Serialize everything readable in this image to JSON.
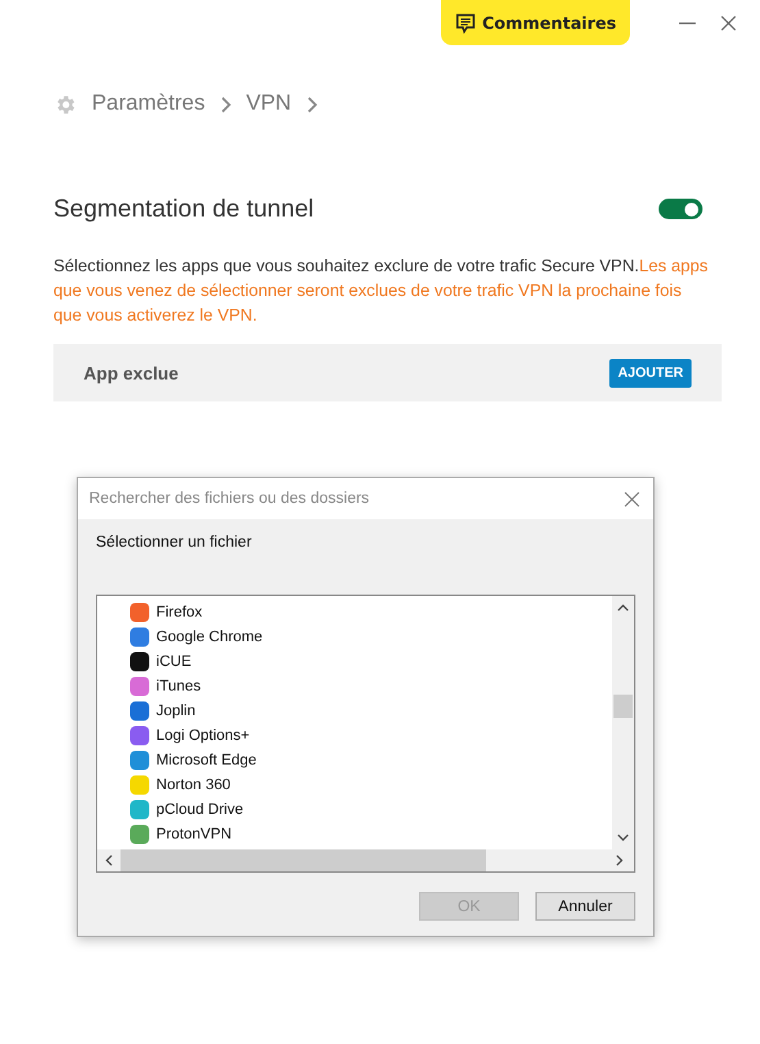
{
  "top_bar": {
    "feedback_button": "Commentaires"
  },
  "breadcrumb": [
    "Paramètres",
    "VPN"
  ],
  "section": {
    "title": "Segmentation de tunnel",
    "toggle_on": true,
    "description": "Sélectionnez les apps que vous souhaitez exclure de votre trafic Secure VPN.",
    "warning": "Les apps que vous venez de sélectionner seront exclues de votre trafic VPN la prochaine fois que vous activerez le VPN."
  },
  "excluded_apps": {
    "label": "App exclue",
    "add_button": "AJOUTER"
  },
  "dialog": {
    "title": "Rechercher des fichiers ou des dossiers",
    "prompt": "Sélectionner un fichier",
    "items": [
      {
        "name": "Firefox",
        "color": "#f2612b"
      },
      {
        "name": "Google Chrome",
        "color": "#2f7de1"
      },
      {
        "name": "iCUE",
        "color": "#111111"
      },
      {
        "name": "iTunes",
        "color": "#d86bd6"
      },
      {
        "name": "Joplin",
        "color": "#1a6fd6"
      },
      {
        "name": "Logi Options+",
        "color": "#8a5cf0"
      },
      {
        "name": "Microsoft Edge",
        "color": "#1f8fd8"
      },
      {
        "name": "Norton 360",
        "color": "#f5d800"
      },
      {
        "name": "pCloud Drive",
        "color": "#1fb7c8"
      },
      {
        "name": "ProtonVPN",
        "color": "#5aaa5a"
      }
    ],
    "buttons": [
      {
        "label": "OK",
        "disabled": true
      },
      {
        "label": "Annuler",
        "disabled": false
      }
    ]
  }
}
